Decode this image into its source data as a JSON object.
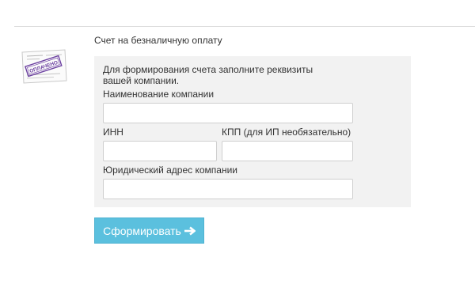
{
  "section": {
    "title": "Счет на безналичную оплату",
    "thumbnail_icon": "paid-invoice-stamp-icon",
    "thumbnail_stamp_text": "ОПЛАЧЕНО"
  },
  "form": {
    "intro": "Для формирования счета заполните реквизиты вашей компании.",
    "company_name": {
      "label": "Наименование компании",
      "value": ""
    },
    "inn": {
      "label": "ИНН",
      "value": ""
    },
    "kpp": {
      "label": "КПП (для ИП необязательно)",
      "value": ""
    },
    "address": {
      "label": "Юридический адрес компании",
      "value": ""
    },
    "submit_label": "Сформировать",
    "submit_icon": "arrow-right-icon"
  },
  "colors": {
    "panel_background": "#f2f2f2",
    "button_background": "#5bc0de",
    "button_text": "#ffffff",
    "stamp": "#6b3fa0"
  }
}
